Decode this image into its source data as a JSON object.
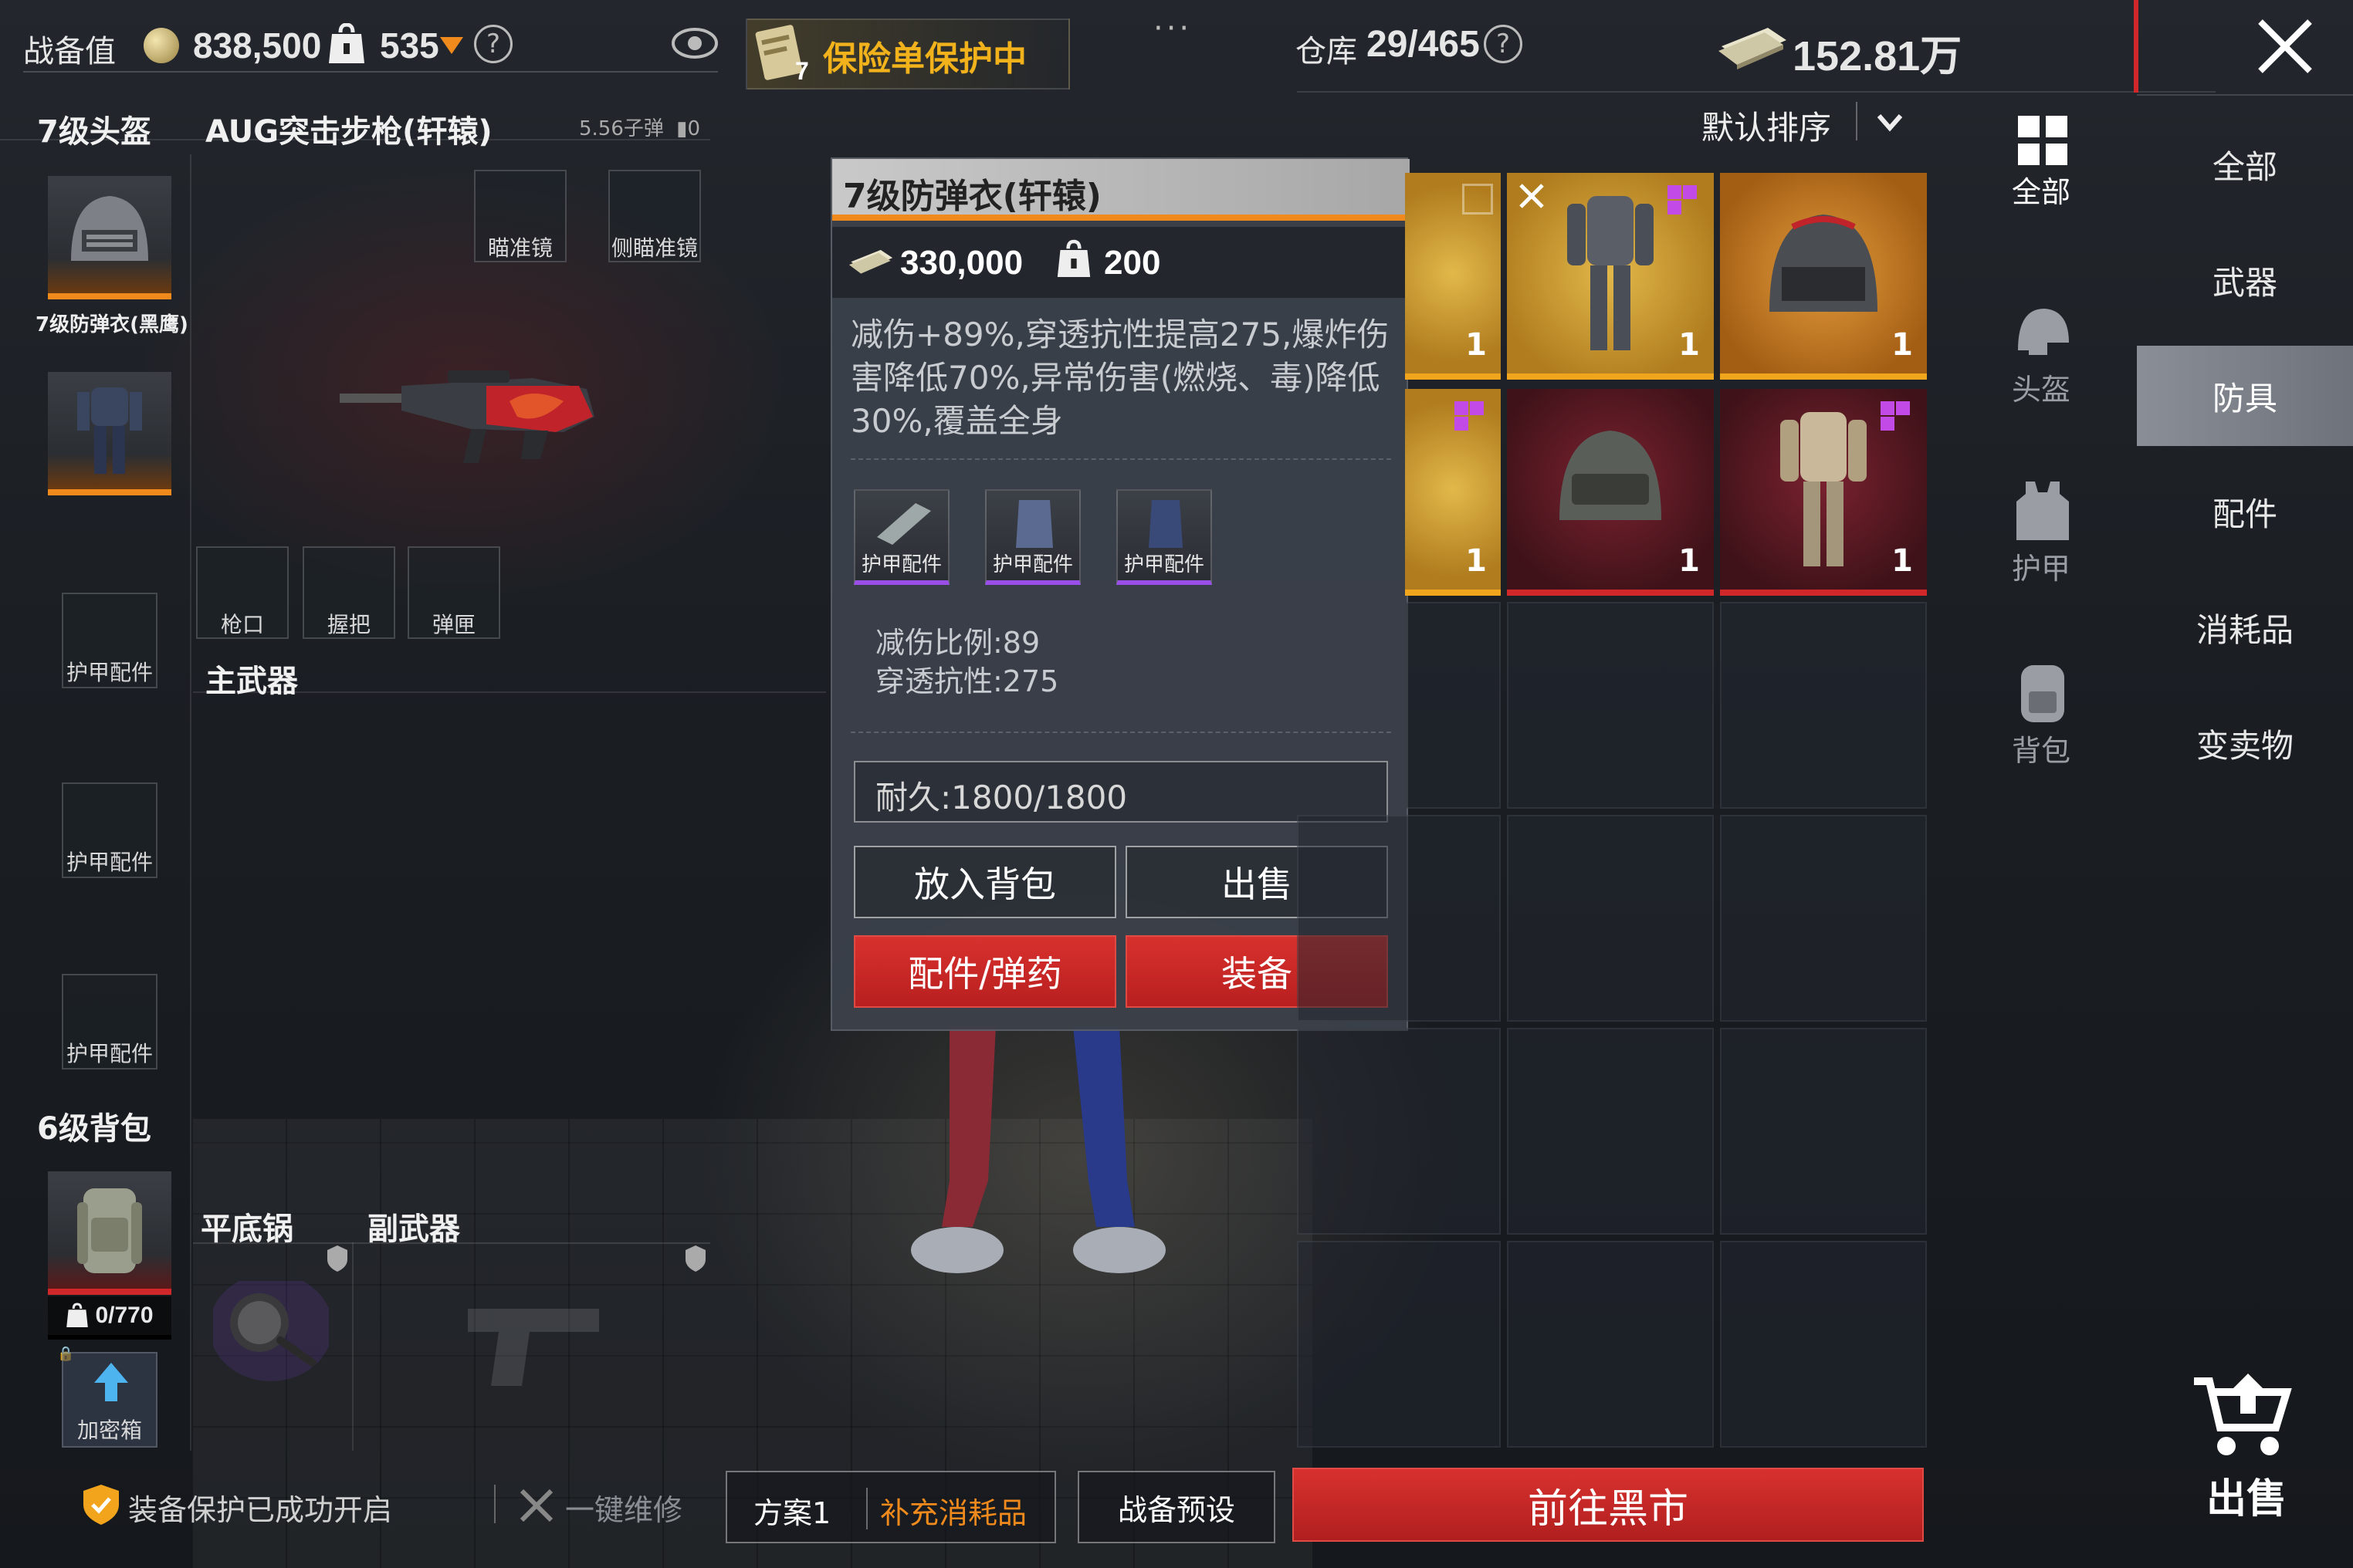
{
  "topbar": {
    "combat_value_label": "战备值",
    "combat_value": "838,500",
    "weight_value": "535",
    "insurance_badge": "7",
    "insurance_text": "保险单保护中",
    "more_dots": "···",
    "warehouse_label": "仓库",
    "warehouse_value": "29/465",
    "money": "152.81万"
  },
  "loadout": {
    "helmet_title": "7级头盔",
    "weapon_title": "AUG突击步枪(轩辕)",
    "ammo": "5.56子弹",
    "ammo_count": "0",
    "scope_label": "瞄准镜",
    "side_scope_label": "侧瞄准镜",
    "armor_name_label": "7级防弹衣(黑鹰)",
    "muzzle_label": "枪口",
    "grip_label": "握把",
    "mag_label": "弹匣",
    "main_weapon_title": "主武器",
    "armor_part_label": "护甲配件",
    "backpack_title": "6级背包",
    "backpack_capacity": "0/770",
    "pan_title": "平底锅",
    "secondary_title": "副武器",
    "secure_box_label": "加密箱"
  },
  "popup": {
    "title": "7级防弹衣(轩辕)",
    "price": "330,000",
    "weight": "200",
    "description": "减伤+89%,穿透抗性提高275,爆炸伤害降低70%,异常伤害(燃烧、毒)降低30%,覆盖全身",
    "parts": [
      "护甲配件",
      "护甲配件",
      "护甲配件"
    ],
    "stat_damage_reduction": "减伤比例:89",
    "stat_penetration": "穿透抗性:275",
    "durability": "耐久:1800/1800",
    "btn_put_backpack": "放入背包",
    "btn_sell": "出售",
    "btn_parts_ammo": "配件/弹药",
    "btn_equip": "装备"
  },
  "sort": {
    "label": "默认排序"
  },
  "grid": {
    "counts": [
      "1",
      "1",
      "1",
      "1",
      "1",
      "1"
    ]
  },
  "categories": [
    {
      "label": "全部",
      "icon": "grid-icon"
    },
    {
      "label": "头盔",
      "icon": "helmet-icon"
    },
    {
      "label": "护甲",
      "icon": "vest-icon"
    },
    {
      "label": "背包",
      "icon": "backpack-icon"
    }
  ],
  "right_nav": [
    "全部",
    "武器",
    "防具",
    "配件",
    "消耗品",
    "变卖物"
  ],
  "right_nav_active": "防具",
  "bottom": {
    "protection_text": "装备保护已成功开启",
    "repair_text": "一键维修",
    "plan_label": "方案1",
    "refill_label": "补充消耗品",
    "preset_label": "战备预设",
    "black_market_label": "前往黑市",
    "sell_label": "出售"
  },
  "colors": {
    "accent_orange": "#f08a1c",
    "accent_red": "#d0282a",
    "insurance_yellow": "#f2b21c",
    "purple_tag": "#c24be8"
  }
}
